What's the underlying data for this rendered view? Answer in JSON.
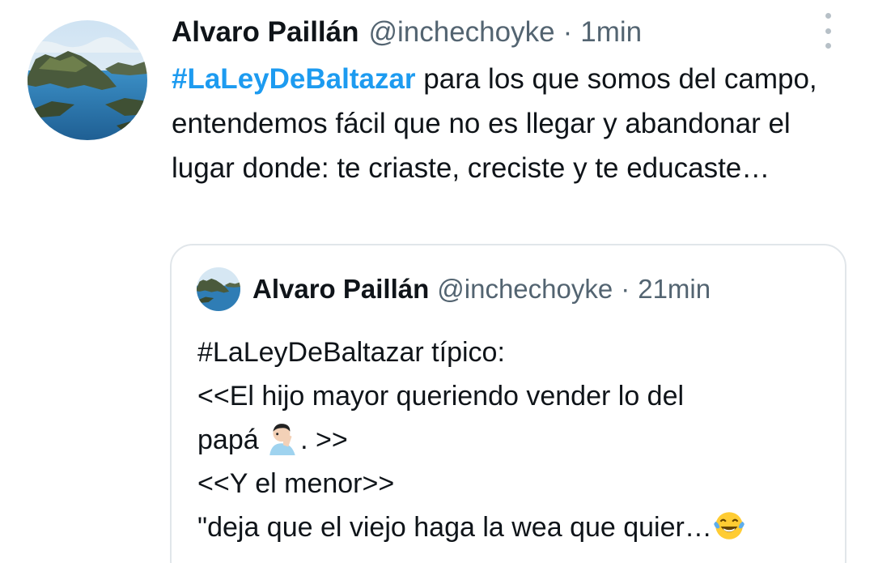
{
  "tweet": {
    "author_name": "Alvaro Paillán",
    "handle": "@inchechoyke",
    "separator": "·",
    "time": "1min",
    "hashtag": "#LaLeyDeBaltazar",
    "text": " para los que somos del campo, entendemos fácil que no es llegar y abandonar el lugar donde: te criaste, creciste y te educaste…",
    "avatar_icon": "landscape-avatar",
    "more_icon": "more-vertical-icon"
  },
  "quoted_tweet": {
    "author_name": "Alvaro Paillán",
    "handle": "@inchechoyke",
    "separator": "·",
    "time": "21min",
    "lines": [
      "#LaLeyDeBaltazar típico:",
      "<<El hijo mayor queriendo vender lo del",
      "papá ",
      ". >>",
      "<<Y el menor>>",
      " \"deja que el viejo haga la wea que quier…"
    ],
    "emoji_facepalm": "man-facepalming-emoji",
    "emoji_laughing": "face-with-tears-of-joy-emoji"
  },
  "colors": {
    "hashtag": "#1d9bf0",
    "text": "#0f1419",
    "secondary": "#536471",
    "border": "#e1e6ea"
  }
}
